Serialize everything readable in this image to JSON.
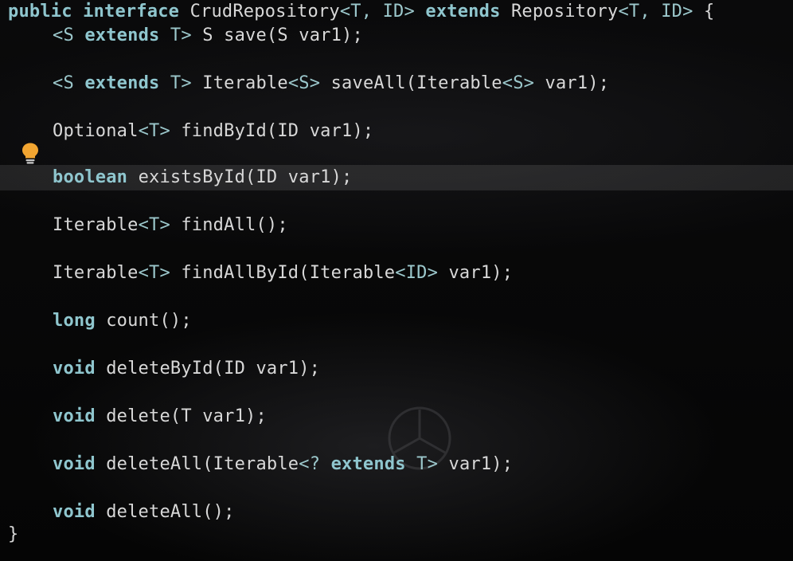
{
  "editor": {
    "lines": [
      {
        "tokens": [
          {
            "t": "public",
            "c": "kw"
          },
          {
            "t": " ",
            "c": "plain"
          },
          {
            "t": "interface",
            "c": "kw"
          },
          {
            "t": " CrudRepository",
            "c": "plain"
          },
          {
            "t": "<T, ID>",
            "c": "tp"
          },
          {
            "t": " ",
            "c": "plain"
          },
          {
            "t": "extends",
            "c": "kw"
          },
          {
            "t": " Repository",
            "c": "plain"
          },
          {
            "t": "<T, ID>",
            "c": "tp"
          },
          {
            "t": " {",
            "c": "plain"
          }
        ]
      },
      {
        "tokens": [
          {
            "t": "<S ",
            "c": "tp"
          },
          {
            "t": "extends",
            "c": "kw"
          },
          {
            "t": " T>",
            "c": "tp"
          },
          {
            "t": " S save(S var1);",
            "c": "plain"
          }
        ]
      },
      {
        "tokens": [
          {
            "t": "<S ",
            "c": "tp"
          },
          {
            "t": "extends",
            "c": "kw"
          },
          {
            "t": " T>",
            "c": "tp"
          },
          {
            "t": " Iterable",
            "c": "plain"
          },
          {
            "t": "<S>",
            "c": "tp"
          },
          {
            "t": " saveAll(Iterable",
            "c": "plain"
          },
          {
            "t": "<S>",
            "c": "tp"
          },
          {
            "t": " var1);",
            "c": "plain"
          }
        ]
      },
      {
        "tokens": [
          {
            "t": "Optional",
            "c": "plain"
          },
          {
            "t": "<T>",
            "c": "tp"
          },
          {
            "t": " findById(ID var1);",
            "c": "plain"
          }
        ]
      },
      {
        "tokens": [
          {
            "t": "boolean",
            "c": "kw"
          },
          {
            "t": " existsById(ID var1);",
            "c": "plain"
          }
        ]
      },
      {
        "tokens": [
          {
            "t": "Iterable",
            "c": "plain"
          },
          {
            "t": "<T>",
            "c": "tp"
          },
          {
            "t": " findAll();",
            "c": "plain"
          }
        ]
      },
      {
        "tokens": [
          {
            "t": "Iterable",
            "c": "plain"
          },
          {
            "t": "<T>",
            "c": "tp"
          },
          {
            "t": " findAllById(Iterable",
            "c": "plain"
          },
          {
            "t": "<ID>",
            "c": "tp"
          },
          {
            "t": " var1);",
            "c": "plain"
          }
        ]
      },
      {
        "tokens": [
          {
            "t": "long",
            "c": "kw"
          },
          {
            "t": " count();",
            "c": "plain"
          }
        ]
      },
      {
        "tokens": [
          {
            "t": "void",
            "c": "kw"
          },
          {
            "t": " deleteById(ID var1);",
            "c": "plain"
          }
        ]
      },
      {
        "tokens": [
          {
            "t": "void",
            "c": "kw"
          },
          {
            "t": " delete(T var1);",
            "c": "plain"
          }
        ]
      },
      {
        "tokens": [
          {
            "t": "void",
            "c": "kw"
          },
          {
            "t": " deleteAll(Iterable",
            "c": "plain"
          },
          {
            "t": "<? ",
            "c": "tp"
          },
          {
            "t": "extends",
            "c": "kw"
          },
          {
            "t": " T>",
            "c": "tp"
          },
          {
            "t": " var1);",
            "c": "plain"
          }
        ]
      },
      {
        "tokens": [
          {
            "t": "void",
            "c": "kw"
          },
          {
            "t": " deleteAll();",
            "c": "plain"
          }
        ]
      },
      {
        "tokens": [
          {
            "t": "}",
            "c": "plain"
          }
        ]
      }
    ]
  },
  "gutter": {
    "intention_icon": "lightbulb-icon"
  },
  "colors": {
    "keyword": "#8fc6ce",
    "type_param": "#9cc8cc",
    "text": "#d8d8d8",
    "current_line": "#252525",
    "bulb": "#f2a531"
  }
}
